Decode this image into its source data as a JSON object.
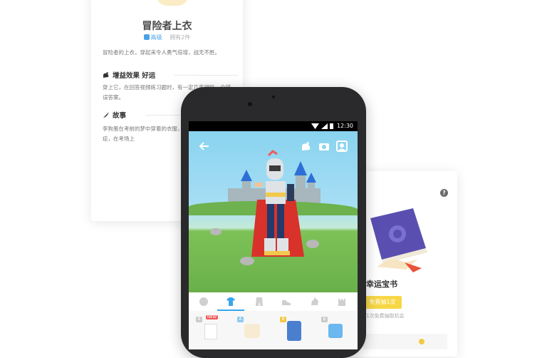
{
  "detail_card": {
    "title": "冒险者上衣",
    "level": "高级",
    "owned": "拥有2件",
    "description": "冒险者的上衣，穿起来令人勇气倍增，战无不胜。",
    "effect_title": "增益效果  好运",
    "effect_text": "穿上它，在回答视频练习题时，有一定几率排除一个错误答案。",
    "story_title": "故事",
    "story_text": "李狗蛋在考前的梦中穿着的衣服，有效缓解考前焦虑症，在考场上"
  },
  "phone": {
    "status_time": "12:30",
    "tabs": [
      "face-icon",
      "shirt-icon",
      "pants-icon",
      "shoes-icon",
      "pet-icon",
      "castle-icon"
    ],
    "items": [
      {
        "tag": "B",
        "badge": "NEW"
      },
      {
        "tag": "A",
        "badge": ""
      },
      {
        "tag": "B",
        "badge": ""
      },
      {
        "tag": "B",
        "badge": ""
      }
    ]
  },
  "lucky_card": {
    "title": "幸运宝书",
    "button": "免费抽1次",
    "note": "1次免费抽取机会"
  },
  "colors": {
    "accent_blue": "#39a6ec",
    "draw_yellow": "#f8d747",
    "cape_red": "#d8322b"
  }
}
